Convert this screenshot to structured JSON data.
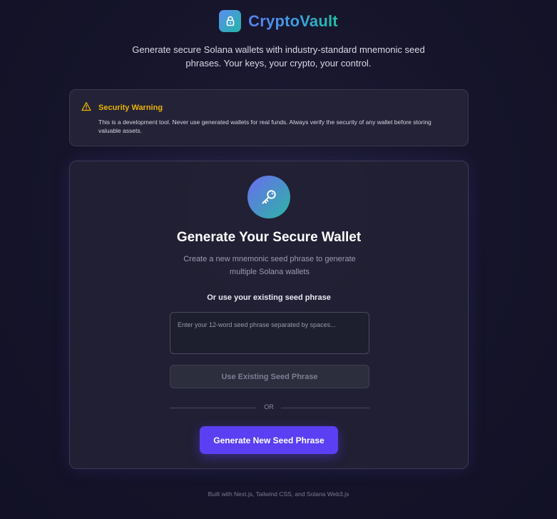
{
  "header": {
    "title": "CryptoVault",
    "tagline": "Generate secure Solana wallets with industry-standard mnemonic seed phrases. Your keys, your crypto, your control."
  },
  "warning": {
    "title": "Security Warning",
    "text": "This is a development tool. Never use generated wallets for real funds. Always verify the security of any wallet before storing valuable assets."
  },
  "card": {
    "title": "Generate Your Secure Wallet",
    "subtitle": "Create a new mnemonic seed phrase to generate multiple Solana wallets",
    "seed_label": "Or use your existing seed phrase",
    "seed_placeholder": "Enter your 12-word seed phrase separated by spaces...",
    "seed_value": "",
    "use_existing_label": "Use Existing Seed Phrase",
    "divider_text": "OR",
    "generate_label": "Generate New Seed Phrase"
  },
  "footer": {
    "text": "Built with Next.js, Tailwind CSS, and Solana Web3.js"
  },
  "colors": {
    "accent": "#5b3ff2",
    "warning": "#eab308",
    "brand_gradient_start": "#5b8def",
    "brand_gradient_end": "#22b6a8"
  },
  "icons": {
    "brand": "lock-icon",
    "warning": "warning-triangle-icon",
    "card": "key-icon"
  }
}
